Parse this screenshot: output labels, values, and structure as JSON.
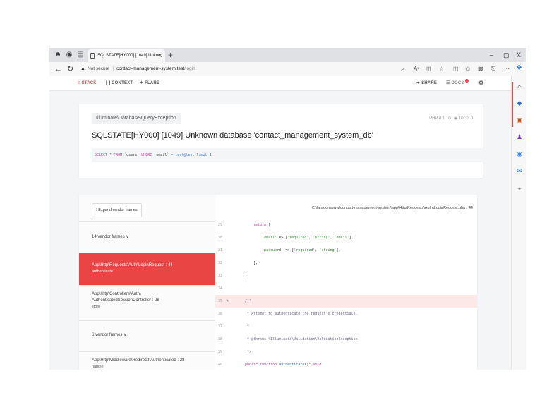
{
  "browser": {
    "tab_title": "SQLSTATE[HY000] [1049] Unkno",
    "tab_close": "x",
    "new_tab": "+",
    "address": {
      "warning": "▲",
      "not_secure": "Not secure",
      "separator": "|",
      "host": "contact-management-system.test",
      "path": "/login"
    },
    "toolbar_icons": [
      "search-icon",
      "read-aloud-icon",
      "reader-icon",
      "favorite-icon",
      "split-screen-icon",
      "favorites-icon",
      "collections-icon",
      "extensions-icon",
      "more-icon",
      "copilot-icon"
    ],
    "window_controls": {
      "minimize": "–",
      "restore": "▢",
      "close": "X"
    },
    "sidebar_icons": [
      "search-icon",
      "shopping-icon",
      "tools-icon",
      "games-icon",
      "office-icon",
      "outlook-icon",
      "add-icon"
    ]
  },
  "ignition_nav": {
    "stack": "STACK",
    "context": "CONTEXT",
    "flare": "FLARE",
    "share": "SHARE",
    "docs": "DOCS"
  },
  "exception": {
    "class": "Illuminate\\Database\\QueryException",
    "php_version": "PHP 8.1.10",
    "laravel_version": "10.33.0",
    "message": "SQLSTATE[HY000] [1049] Unknown database 'contact_management_system_db'",
    "sql": {
      "select": "SELECT",
      "star": " * ",
      "from": "FROM",
      "table": " `users` ",
      "where": "WHERE",
      "column": " `email` ",
      "rest": "= test@test limit 1"
    }
  },
  "stack": {
    "expand_label": "⁝ Expand vendor frames",
    "file_path": "C:\\laragon\\www\\contact-management-system\\app\\Http\\Requests\\Auth\\LoginRequest.php : 44",
    "frames": [
      {
        "l1": "14 vendor frames ∨",
        "l2": ""
      },
      {
        "l1": "App\\Http\\Requests\\Auth\\LoginRequest : 44",
        "l2": "authenticate"
      },
      {
        "l1": "App\\Http\\Controllers\\Auth\\",
        "l1b": "AuthenticatedSessionController : 28",
        "l2": "store"
      },
      {
        "l1": "6 vendor frames ∨",
        "l2": ""
      },
      {
        "l1": "App\\Http\\Middleware\\RedirectIfAuthenticated : 28",
        "l2": "handle"
      }
    ],
    "code_lines": [
      {
        "n": "29",
        "html": [
          [
            "k",
            "        return "
          ],
          [
            "p",
            "["
          ]
        ]
      },
      {
        "n": "30",
        "html": [
          [
            "s",
            "            'email' "
          ],
          [
            "p",
            "=> ["
          ],
          [
            "s",
            "'required'"
          ],
          [
            "p",
            ", "
          ],
          [
            "s",
            "'string'"
          ],
          [
            "p",
            ", "
          ],
          [
            "s",
            "'email'"
          ],
          [
            "p",
            "],"
          ]
        ]
      },
      {
        "n": "31",
        "html": [
          [
            "s",
            "            'password' "
          ],
          [
            "p",
            "=> ["
          ],
          [
            "s",
            "'required'"
          ],
          [
            "p",
            ", "
          ],
          [
            "s",
            "'string'"
          ],
          [
            "p",
            "],"
          ]
        ]
      },
      {
        "n": "32",
        "html": [
          [
            "p",
            "        ];"
          ]
        ]
      },
      {
        "n": "33",
        "html": [
          [
            "p",
            "    }"
          ]
        ]
      },
      {
        "n": "34",
        "html": [
          [
            "p",
            ""
          ]
        ]
      },
      {
        "n": "35",
        "html": [
          [
            "c",
            "    /**"
          ]
        ],
        "highlight": true
      },
      {
        "n": "36",
        "html": [
          [
            "c",
            "     * Attempt to authenticate the request's credentials."
          ]
        ]
      },
      {
        "n": "37",
        "html": [
          [
            "c",
            "     *"
          ]
        ]
      },
      {
        "n": "38",
        "html": [
          [
            "c",
            "     * @throws \\Illuminate\\Validation\\ValidationException"
          ]
        ]
      },
      {
        "n": "39",
        "html": [
          [
            "c",
            "     */"
          ]
        ]
      },
      {
        "n": "40",
        "html": [
          [
            "k",
            "    public function "
          ],
          [
            "f",
            "authenticate"
          ],
          [
            "p",
            "(): "
          ],
          [
            "k",
            "void"
          ]
        ]
      }
    ]
  }
}
